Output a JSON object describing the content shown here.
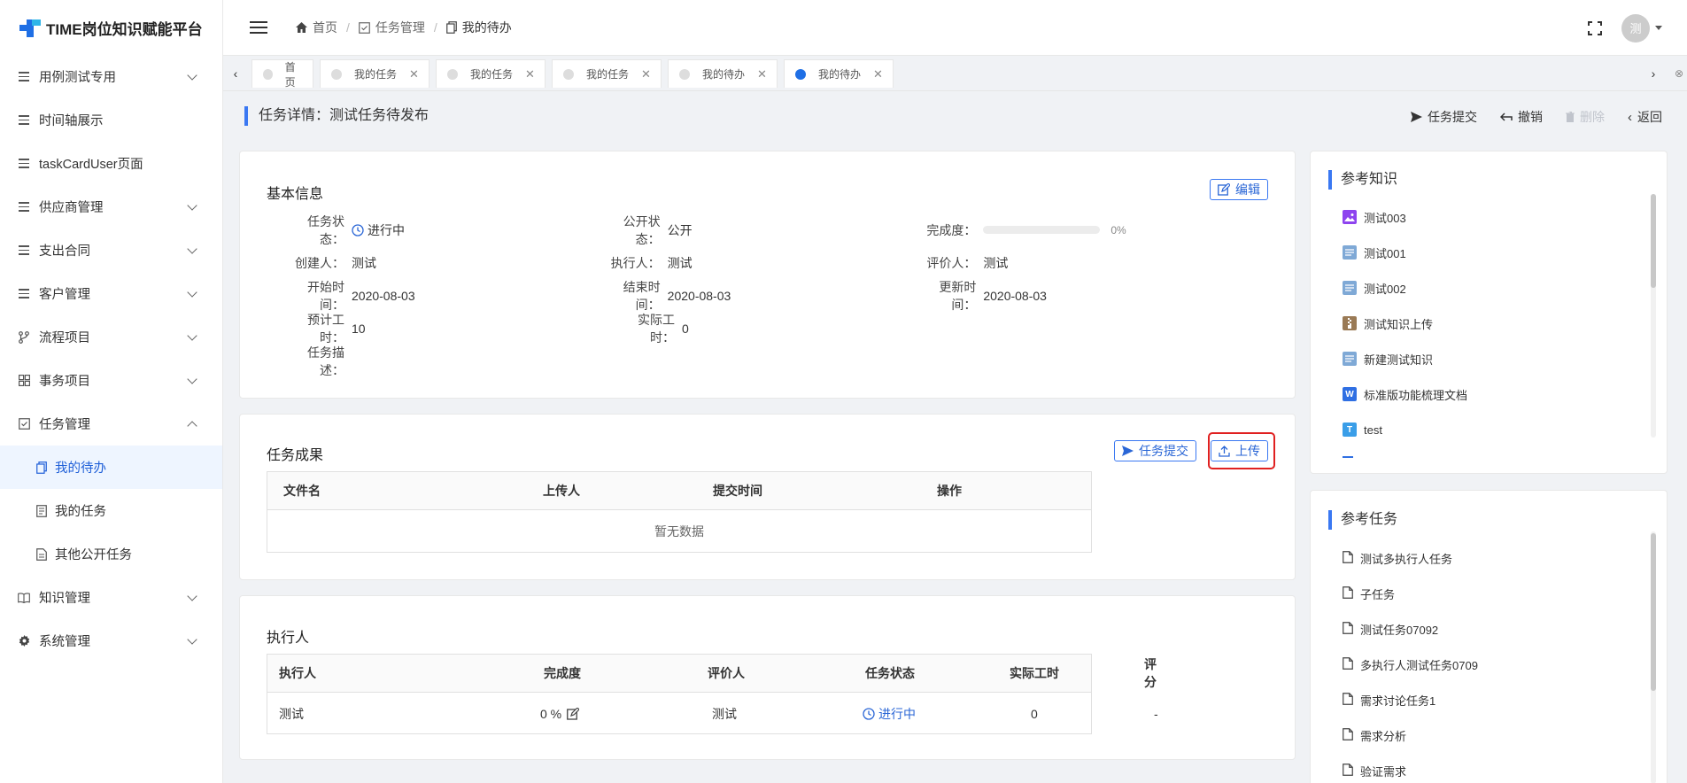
{
  "app": {
    "title": "TIME岗位知识赋能平台"
  },
  "sidebar": {
    "items": [
      {
        "label": "用例测试专用",
        "icon": "list-icon",
        "expandable": true
      },
      {
        "label": "时间轴展示",
        "icon": "list-icon",
        "expandable": false
      },
      {
        "label": "taskCardUser页面",
        "icon": "list-icon",
        "expandable": false
      },
      {
        "label": "供应商管理",
        "icon": "list-icon",
        "expandable": true
      },
      {
        "label": "支出合同",
        "icon": "list-icon",
        "expandable": true
      },
      {
        "label": "客户管理",
        "icon": "list-icon",
        "expandable": true
      },
      {
        "label": "流程项目",
        "icon": "branch-icon",
        "expandable": true
      },
      {
        "label": "事务项目",
        "icon": "grid-icon",
        "expandable": true
      },
      {
        "label": "任务管理",
        "icon": "checkbox-icon",
        "expandable": true,
        "expanded": true
      }
    ],
    "task_sub": [
      {
        "label": "我的待办",
        "icon": "copy-icon",
        "active": true
      },
      {
        "label": "我的任务",
        "icon": "list-doc-icon"
      },
      {
        "label": "其他公开任务",
        "icon": "file-icon"
      }
    ],
    "bottom_items": [
      {
        "label": "知识管理",
        "icon": "book-icon"
      },
      {
        "label": "系统管理",
        "icon": "gear-icon"
      }
    ]
  },
  "header": {
    "breadcrumb": [
      "首页",
      "任务管理",
      "我的待办"
    ],
    "avatar_text": "测"
  },
  "tabs": [
    {
      "label": "首页",
      "closable": false,
      "active": false
    },
    {
      "label": "我的任务",
      "closable": true,
      "active": false
    },
    {
      "label": "我的任务",
      "closable": true,
      "active": false
    },
    {
      "label": "我的任务",
      "closable": true,
      "active": false
    },
    {
      "label": "我的待办",
      "closable": true,
      "active": false
    },
    {
      "label": "我的待办",
      "closable": true,
      "active": true
    }
  ],
  "page": {
    "title": "任务详情：测试任务待发布",
    "actions": {
      "submit": "任务提交",
      "revoke": "撤销",
      "delete": "删除",
      "back": "返回"
    }
  },
  "basic_info": {
    "title": "基本信息",
    "edit_label": "编辑",
    "fields": {
      "status_k": "任务状态：",
      "status_v": "进行中",
      "public_k": "公开状态：",
      "public_v": "公开",
      "progress_k": "完成度：",
      "progress_v": "0%",
      "progress_fraction": 0,
      "creator_k": "创建人：",
      "creator_v": "测试",
      "executor_k": "执行人：",
      "executor_v": "测试",
      "reviewer_k": "评价人：",
      "reviewer_v": "测试",
      "start_k": "开始时间：",
      "start_v": "2020-08-03",
      "end_k": "结束时间：",
      "end_v": "2020-08-03",
      "update_k": "更新时间：",
      "update_v": "2020-08-03",
      "est_k": "预计工时：",
      "est_v": "10",
      "actual_k": "实际工时：",
      "actual_v": "0",
      "desc_k": "任务描述：",
      "desc_v": ""
    }
  },
  "results": {
    "title": "任务成果",
    "submit_label": "任务提交",
    "upload_label": "上传",
    "columns": [
      "文件名",
      "上传人",
      "提交时间",
      "操作"
    ],
    "empty_text": "暂无数据"
  },
  "executors": {
    "title": "执行人",
    "columns": [
      "执行人",
      "完成度",
      "评价人",
      "任务状态",
      "实际工时",
      "评分"
    ],
    "rows": [
      {
        "executor": "测试",
        "progress": "0 %",
        "reviewer": "测试",
        "status": "进行中",
        "actual_hours": "0",
        "score": "-"
      }
    ]
  },
  "ref_knowledge": {
    "title": "参考知识",
    "items": [
      {
        "label": "测试003",
        "icon": "image-icon",
        "color": "#8e44ef"
      },
      {
        "label": "测试001",
        "icon": "doc-icon",
        "color": "#7fa9d6"
      },
      {
        "label": "测试002",
        "icon": "doc-icon",
        "color": "#7fa9d6"
      },
      {
        "label": "测试知识上传",
        "icon": "zip-icon",
        "color": "#9a7a55"
      },
      {
        "label": "新建测试知识",
        "icon": "doc-icon",
        "color": "#7fa9d6"
      },
      {
        "label": "标准版功能梳理文档",
        "icon": "word-icon",
        "color": "#2f6fe3",
        "glyph": "W"
      },
      {
        "label": "test",
        "icon": "text-icon",
        "color": "#3a9ee8",
        "glyph": "T"
      }
    ]
  },
  "ref_tasks": {
    "title": "参考任务",
    "items": [
      "测试多执行人任务",
      "子任务",
      "测试任务07092",
      "多执行人测试任务0709",
      "需求讨论任务1",
      "需求分析",
      "验证需求"
    ]
  }
}
